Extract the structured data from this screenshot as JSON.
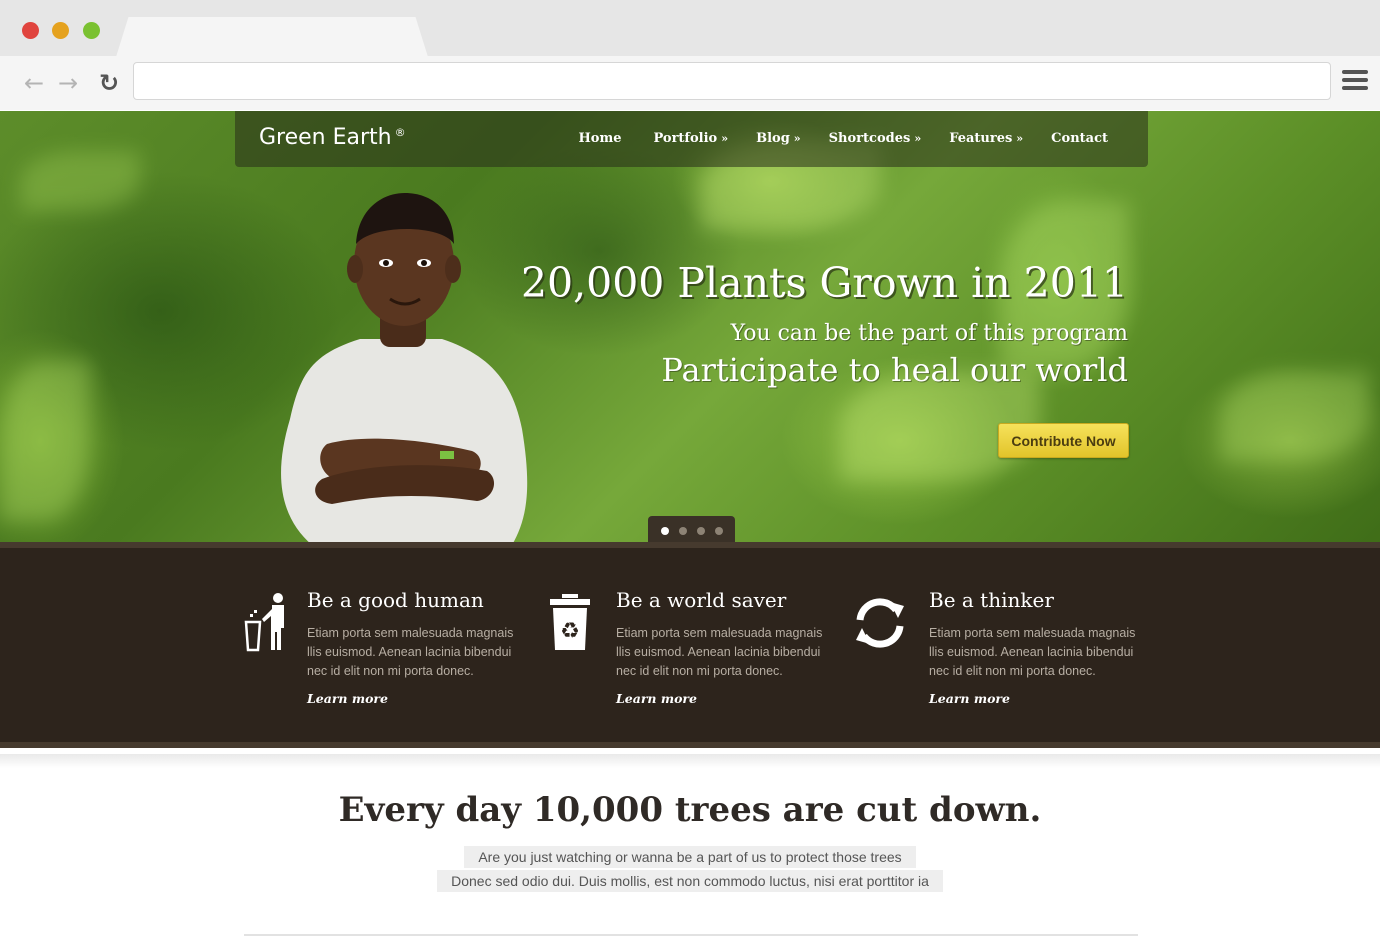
{
  "browser": {
    "back_icon": "arrow-left-icon",
    "forward_icon": "arrow-right-icon",
    "reload_icon": "reload-icon",
    "menu_icon": "hamburger-menu-icon",
    "url": ""
  },
  "site": {
    "logo": "Green Earth",
    "logo_mark": "®",
    "nav": [
      {
        "label": "Home",
        "dropdown": ""
      },
      {
        "label": "Portfolio",
        "dropdown": "»"
      },
      {
        "label": "Blog",
        "dropdown": "»"
      },
      {
        "label": "Shortcodes",
        "dropdown": "»"
      },
      {
        "label": "Features",
        "dropdown": "»"
      },
      {
        "label": "Contact",
        "dropdown": ""
      }
    ]
  },
  "hero": {
    "headline": "20,000 Plants Grown in 2011",
    "subline": "You can be the part of this program",
    "tagline": "Participate to heal our world",
    "cta": "Contribute Now",
    "slides": 4,
    "active_slide": 1
  },
  "features": [
    {
      "icon": "person-trash-icon",
      "title": "Be a good human",
      "text": "Etiam porta sem malesuada magnais llis euismod. Aenean lacinia bibendui nec id elit non mi porta donec.",
      "link": "Learn more"
    },
    {
      "icon": "recycle-bin-icon",
      "title": "Be a world saver",
      "text": "Etiam porta sem malesuada magnais llis euismod. Aenean lacinia bibendui nec id elit non mi porta donec.",
      "link": "Learn more"
    },
    {
      "icon": "refresh-arrows-icon",
      "title": "Be a thinker",
      "text": "Etiam porta sem malesuada magnais llis euismod. Aenean lacinia bibendui nec id elit non mi porta donec.",
      "link": "Learn more"
    }
  ],
  "content": {
    "title": "Every day 10,000 trees are cut down.",
    "line1": "Are you just watching or wanna be a part of us to protect those trees",
    "line2": "Donec sed odio dui. Duis mollis, est non commodo luctus, nisi erat porttitor ia"
  },
  "colors": {
    "accent_button": "#f0d64a",
    "features_bg": "#2d241c",
    "hero_green": "#5d8d2a"
  }
}
